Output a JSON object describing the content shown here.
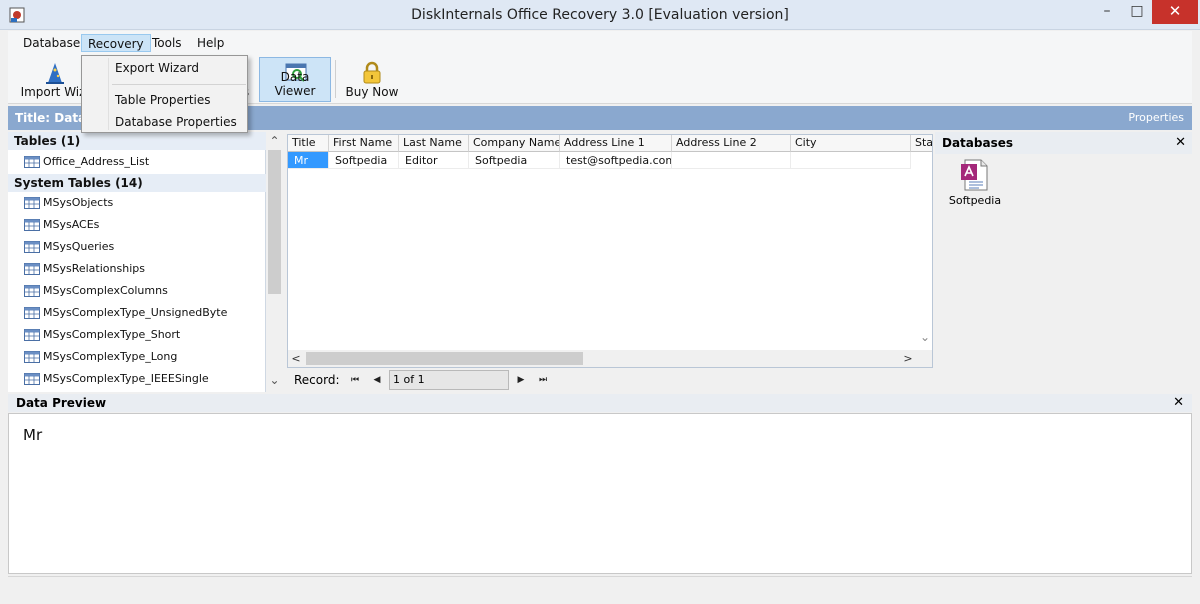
{
  "window": {
    "title": "DiskInternals Office Recovery 3.0 [Evaluation version]",
    "min_glyph": "–",
    "max_glyph": "□",
    "close_glyph": "✕"
  },
  "menu": {
    "database": "Database",
    "recovery": "Recovery",
    "tools": "Tools",
    "help": "Help"
  },
  "dropdown": {
    "export_wizard": "Export Wizard",
    "table_properties": "Table Properties",
    "database_properties": "Database Properties"
  },
  "toolbar": {
    "import_wizard": "Import Wiz",
    "hidden_suffix": "s",
    "data_viewer": "Data Viewer",
    "buy_now": "Buy Now"
  },
  "banner": {
    "title": "Title: Data",
    "properties": "Properties"
  },
  "left_pane": {
    "tables_header": "Tables (1)",
    "tables": [
      "Office_Address_List"
    ],
    "system_header": "System Tables (14)",
    "system_tables": [
      "MSysObjects",
      "MSysACEs",
      "MSysQueries",
      "MSysRelationships",
      "MSysComplexColumns",
      "MSysComplexType_UnsignedByte",
      "MSysComplexType_Short",
      "MSysComplexType_Long",
      "MSysComplexType_IEEESingle"
    ]
  },
  "grid": {
    "columns": [
      "Title",
      "First Name",
      "Last Name",
      "Company Name",
      "Address Line 1",
      "Address Line 2",
      "City",
      "Sta"
    ],
    "rows": [
      [
        "Mr",
        "Softpedia",
        "Editor",
        "Softpedia",
        "test@softpedia.com",
        "",
        "",
        ""
      ]
    ]
  },
  "record_bar": {
    "label": "Record:",
    "value": "1 of 1",
    "first": "⏮",
    "prev": "◀",
    "next": "▶",
    "last": "⏭"
  },
  "databases": {
    "header": "Databases",
    "close": "✕",
    "item": "Softpedia"
  },
  "preview": {
    "header": "Data Preview",
    "close": "✕",
    "text": "Mr"
  },
  "scroll_glyphs": {
    "up": "⌃",
    "down": "⌄",
    "left": "<",
    "right": ">"
  }
}
